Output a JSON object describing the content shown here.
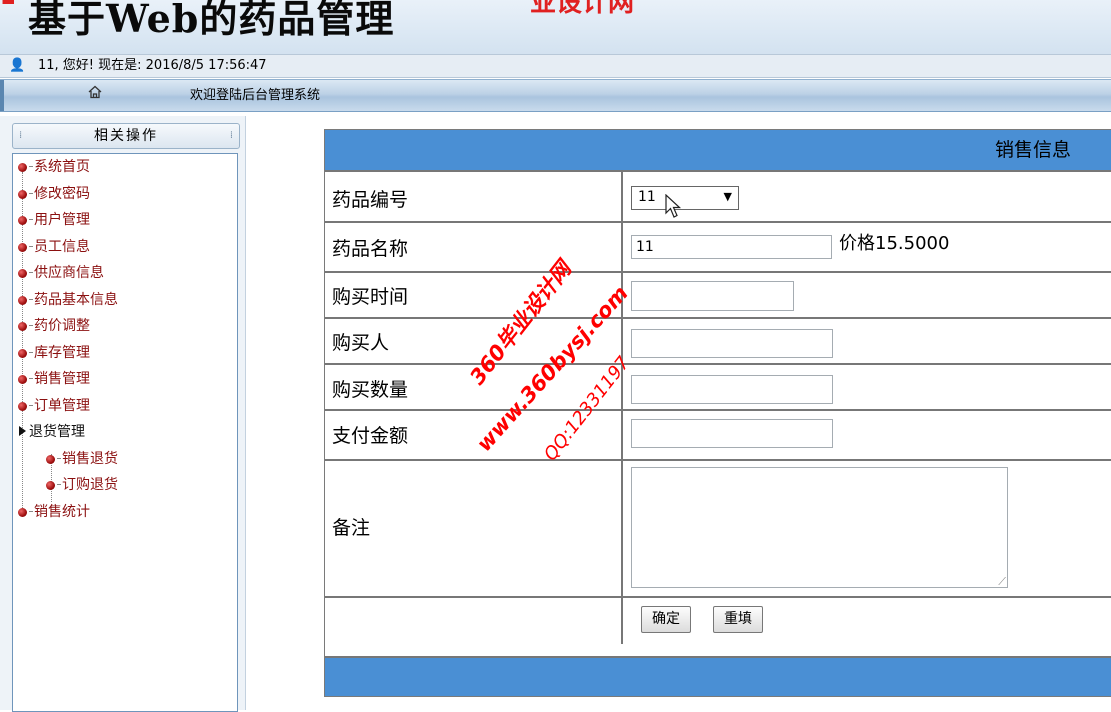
{
  "header": {
    "title": "基于Web的药品管理",
    "red_fragment": "业设计网"
  },
  "userbar": {
    "greeting": "11, 您好! 现在是: 2016/8/5 17:56:47"
  },
  "navbar": {
    "welcome": "欢迎登陆后台管理系统"
  },
  "sidebar": {
    "title": "相关操作",
    "items": [
      {
        "label": "系统首页"
      },
      {
        "label": "修改密码"
      },
      {
        "label": "用户管理"
      },
      {
        "label": "员工信息"
      },
      {
        "label": "供应商信息"
      },
      {
        "label": "药品基本信息"
      },
      {
        "label": "药价调整"
      },
      {
        "label": "库存管理"
      },
      {
        "label": "销售管理"
      },
      {
        "label": "订单管理"
      },
      {
        "label": "退货管理"
      },
      {
        "label": "销售退货"
      },
      {
        "label": "订购退货"
      },
      {
        "label": "销售统计"
      }
    ]
  },
  "form": {
    "title": "销售信息",
    "fields": {
      "drug_id_label": "药品编号",
      "drug_id_value": "11",
      "drug_name_label": "药品名称",
      "drug_name_value": "11",
      "price_text": "价格15.5000",
      "purchase_time_label": "购买时间",
      "purchase_time_value": "",
      "buyer_label": "购买人",
      "buyer_value": "",
      "quantity_label": "购买数量",
      "quantity_value": "",
      "amount_label": "支付金额",
      "amount_value": "",
      "remark_label": "备注",
      "remark_value": ""
    },
    "buttons": {
      "confirm": "确定",
      "reset": "重填"
    }
  },
  "watermark": {
    "line1": "360毕业设计网",
    "line2": "www.360bysj.com",
    "line3": "QQ:12331197"
  },
  "colors": {
    "form_header": "#4a8fd4",
    "menu_text": "#8b1010",
    "watermark": "#ff0000"
  }
}
